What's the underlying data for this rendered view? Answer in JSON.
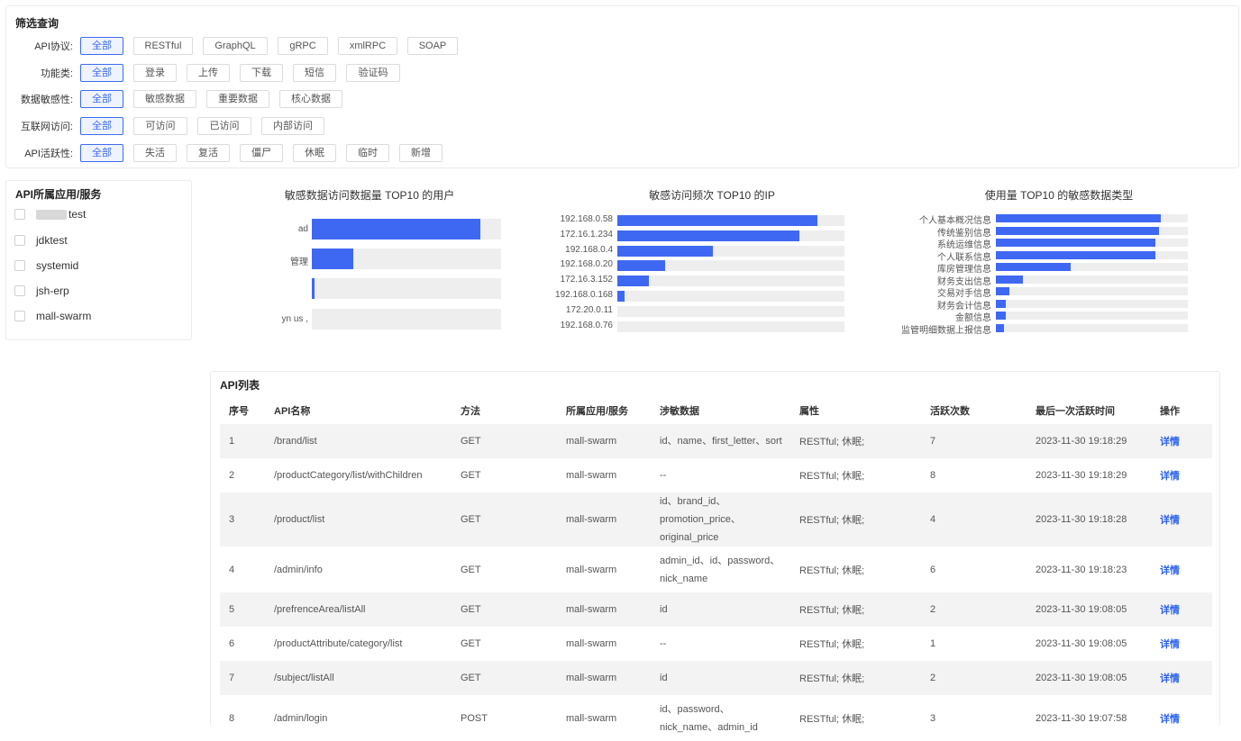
{
  "filter": {
    "title": "筛选查询",
    "rows": [
      {
        "label": "API协议:",
        "options": [
          "全部",
          "RESTful",
          "GraphQL",
          "gRPC",
          "xmlRPC",
          "SOAP"
        ]
      },
      {
        "label": "功能类:",
        "options": [
          "全部",
          "登录",
          "上传",
          "下载",
          "短信",
          "验证码"
        ]
      },
      {
        "label": "数据敏感性:",
        "options": [
          "全部",
          "敏感数据",
          "重要数据",
          "核心数据"
        ]
      },
      {
        "label": "互联网访问:",
        "options": [
          "全部",
          "可访问",
          "已访问",
          "内部访问"
        ]
      },
      {
        "label": "API活跃性:",
        "options": [
          "全部",
          "失活",
          "复活",
          "僵尸",
          "休眠",
          "临时",
          "新增"
        ]
      }
    ]
  },
  "apps": {
    "title": "API所属应用/服务",
    "items": [
      "test",
      "jdktest",
      "systemid",
      "jsh-erp",
      "mall-swarm"
    ]
  },
  "charts": {
    "users": {
      "title": "敏感数据访问数据量 TOP10 的用户",
      "labels": [
        "ad",
        "管理",
        "",
        "yn us , "
      ]
    },
    "ips": {
      "title": "敏感访问频次 TOP10 的IP",
      "labels": [
        "192.168.0.58",
        "172.16.1.234",
        "192.168.0.4",
        "192.168.0.20",
        "172.16.3.152",
        "192.168.0.168",
        "172.20.0.11",
        "192.168.0.76"
      ]
    },
    "types": {
      "title": "使用量 TOP10 的敏感数据类型",
      "labels": [
        "个人基本概况信息",
        "传统鉴别信息",
        "系统运维信息",
        "个人联系信息",
        "库房管理信息",
        "财务支出信息",
        "交易对手信息",
        "财务会计信息",
        "金额信息",
        "监管明细数据上报信息"
      ]
    }
  },
  "chart_data": [
    {
      "type": "bar",
      "orientation": "horizontal",
      "title": "敏感数据访问数据量 TOP10 的用户",
      "categories": [
        "ad",
        "管理",
        "",
        "yn us , "
      ],
      "values": [
        0.89,
        0.22,
        0.015,
        0
      ],
      "value_unit": "fraction of axis max"
    },
    {
      "type": "bar",
      "orientation": "horizontal",
      "title": "敏感访问频次 TOP10 的IP",
      "categories": [
        "192.168.0.58",
        "172.16.1.234",
        "192.168.0.4",
        "192.168.0.20",
        "172.16.3.152",
        "192.168.0.168",
        "172.20.0.11",
        "192.168.0.76"
      ],
      "values": [
        0.88,
        0.8,
        0.42,
        0.21,
        0.14,
        0.03,
        0,
        0
      ],
      "value_unit": "fraction of axis max"
    },
    {
      "type": "bar",
      "orientation": "horizontal",
      "title": "使用量 TOP10 的敏感数据类型",
      "categories": [
        "个人基本概况信息",
        "传统鉴别信息",
        "系统运维信息",
        "个人联系信息",
        "库房管理信息",
        "财务支出信息",
        "交易对手信息",
        "财务会计信息",
        "金额信息",
        "监管明细数据上报信息"
      ],
      "values": [
        0.86,
        0.85,
        0.83,
        0.83,
        0.39,
        0.14,
        0.07,
        0.05,
        0.05,
        0.04
      ],
      "value_unit": "fraction of axis max"
    }
  ],
  "apilist": {
    "title": "API列表",
    "headers": [
      "序号",
      "API名称",
      "方法",
      "所属应用/服务",
      "涉敏数据",
      "属性",
      "活跃次数",
      "最后一次活跃时间",
      "操作"
    ],
    "rows": [
      {
        "no": "1",
        "name": "/brand/list",
        "method": "GET",
        "app": "mall-swarm",
        "data": "id、name、first_letter、sort",
        "attr": "RESTful; 休眠;",
        "count": "7",
        "time": "2023-11-30 19:18:29",
        "op": "详情"
      },
      {
        "no": "2",
        "name": "/productCategory/list/withChildren",
        "method": "GET",
        "app": "mall-swarm",
        "data": "--",
        "attr": "RESTful; 休眠;",
        "count": "8",
        "time": "2023-11-30 19:18:29",
        "op": "详情"
      },
      {
        "no": "3",
        "name": "/product/list",
        "method": "GET",
        "app": "mall-swarm",
        "data": "id、brand_id、promotion_price、original_price",
        "attr": "RESTful; 休眠;",
        "count": "4",
        "time": "2023-11-30 19:18:28",
        "op": "详情"
      },
      {
        "no": "4",
        "name": "/admin/info",
        "method": "GET",
        "app": "mall-swarm",
        "data": "admin_id、id、password、nick_name",
        "attr": "RESTful; 休眠;",
        "count": "6",
        "time": "2023-11-30 19:18:23",
        "op": "详情"
      },
      {
        "no": "5",
        "name": "/prefrenceArea/listAll",
        "method": "GET",
        "app": "mall-swarm",
        "data": "id",
        "attr": "RESTful; 休眠;",
        "count": "2",
        "time": "2023-11-30 19:08:05",
        "op": "详情"
      },
      {
        "no": "6",
        "name": "/productAttribute/category/list",
        "method": "GET",
        "app": "mall-swarm",
        "data": "--",
        "attr": "RESTful; 休眠;",
        "count": "1",
        "time": "2023-11-30 19:08:05",
        "op": "详情"
      },
      {
        "no": "7",
        "name": "/subject/listAll",
        "method": "GET",
        "app": "mall-swarm",
        "data": "id",
        "attr": "RESTful; 休眠;",
        "count": "2",
        "time": "2023-11-30 19:08:05",
        "op": "详情"
      },
      {
        "no": "8",
        "name": "/admin/login",
        "method": "POST",
        "app": "mall-swarm",
        "data": "id、password、nick_name、admin_id",
        "attr": "RESTful; 休眠;",
        "count": "3",
        "time": "2023-11-30 19:07:58",
        "op": "详情"
      }
    ]
  }
}
